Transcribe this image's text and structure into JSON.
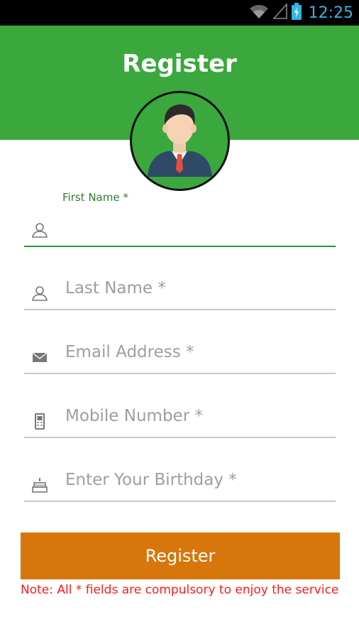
{
  "status_bar": {
    "time": "12:25",
    "icons": [
      "wifi-icon",
      "signal-icon",
      "battery-charging-icon"
    ],
    "clock_color": "#33b5e5"
  },
  "header": {
    "title": "Register",
    "background": "#3aa83c"
  },
  "avatar": {
    "icon": "user-avatar-icon"
  },
  "form": {
    "first_name": {
      "floating_label": "First Name *",
      "value": "",
      "icon": "person-icon",
      "active": true
    },
    "last_name": {
      "placeholder": "Last Name *",
      "icon": "person-icon"
    },
    "email": {
      "placeholder": "Email Address *",
      "icon": "envelope-icon"
    },
    "mobile": {
      "placeholder": "Mobile Number *",
      "icon": "phone-icon"
    },
    "birthday": {
      "placeholder": "Enter Your Birthday *",
      "icon": "cake-icon"
    }
  },
  "register_button": {
    "label": "Register",
    "color": "#d7760a"
  },
  "note": "Note: All * fields are compulsory to enjoy the service"
}
